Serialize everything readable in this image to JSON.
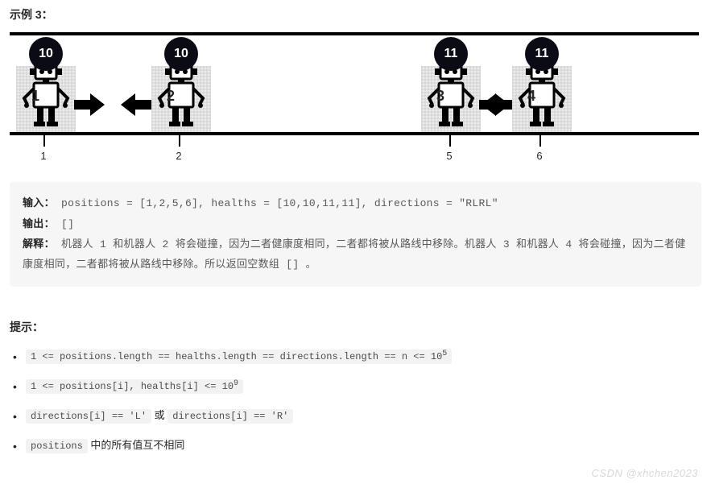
{
  "example_label": "示例 3：",
  "robots": [
    {
      "health": "10",
      "body": "1",
      "direction": "R",
      "pos_label": "1"
    },
    {
      "health": "10",
      "body": "2",
      "direction": "L",
      "pos_label": "2"
    },
    {
      "health": "11",
      "body": "3",
      "direction": "R",
      "pos_label": "5"
    },
    {
      "health": "11",
      "body": "4",
      "direction": "L",
      "pos_label": "6"
    }
  ],
  "io": {
    "input_label": "输入：",
    "input_text": "positions = [1,2,5,6], healths = [10,10,11,11], directions = \"RLRL\"",
    "output_label": "输出：",
    "output_text": "[]",
    "explain_label": "解释：",
    "explain_text": "机器人 1 和机器人 2 将会碰撞，因为二者健康度相同，二者都将被从路线中移除。机器人 3 和机器人 4 将会碰撞，因为二者健康度相同，二者都将被从路线中移除。所以返回空数组 [] 。"
  },
  "hints_label": "提示：",
  "hints": [
    {
      "code_before": "1 <= positions.length == healths.length == directions.length == n <= 10",
      "sup": "5",
      "after": ""
    },
    {
      "code_before": "1 <= positions[i], healths[i] <= 10",
      "sup": "9",
      "after": ""
    },
    {
      "code_before": "directions[i] == 'L'",
      "mid": " 或 ",
      "code_after": "directions[i] == 'R'"
    },
    {
      "code_before": "positions",
      "after": " 中的所有值互不相同"
    }
  ],
  "watermark": "CSDN @xhchen2023"
}
